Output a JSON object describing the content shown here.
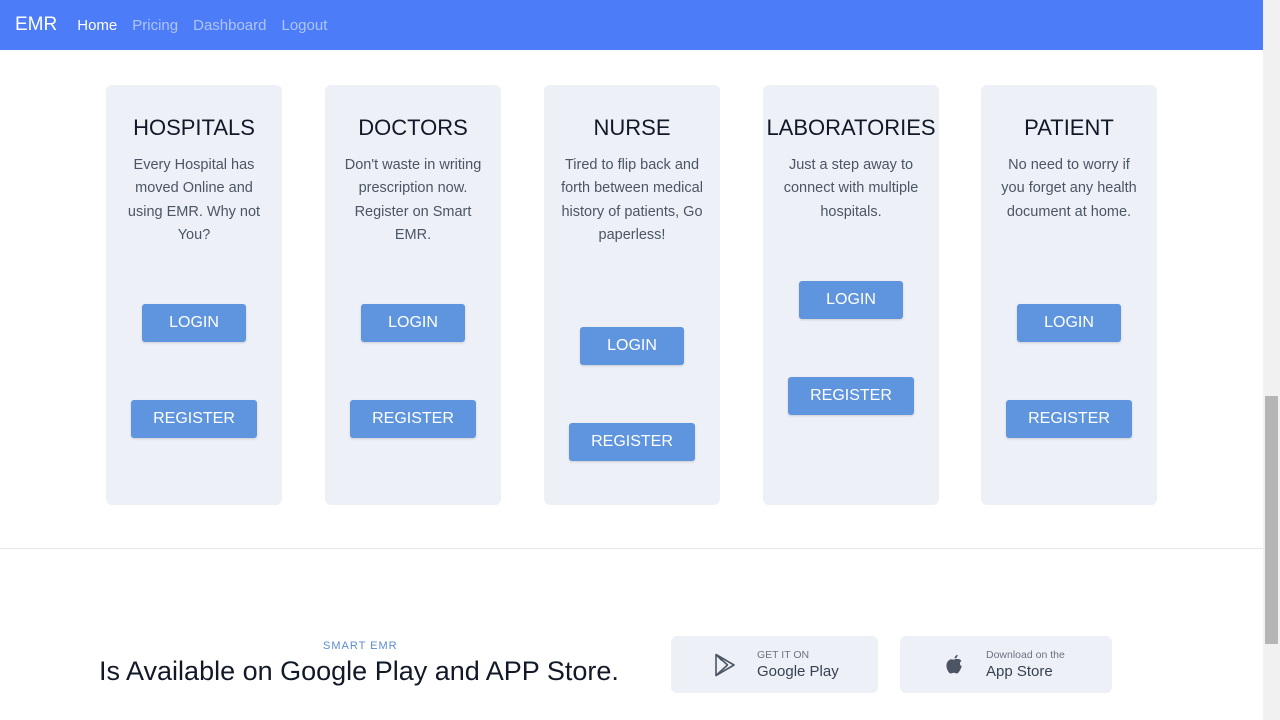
{
  "navbar": {
    "brand": "EMR",
    "links": [
      {
        "label": "Home",
        "active": true
      },
      {
        "label": "Pricing",
        "active": false
      },
      {
        "label": "Dashboard",
        "active": false
      },
      {
        "label": "Logout",
        "active": false
      }
    ]
  },
  "cards": [
    {
      "title": "HOSPITALS",
      "text": "Every Hospital has moved Online and using EMR. Why not You?",
      "login": "LOGIN",
      "register": "REGISTER"
    },
    {
      "title": "DOCTORS",
      "text": "Don't waste in writing prescription now. Register on Smart EMR.",
      "login": "LOGIN",
      "register": "REGISTER"
    },
    {
      "title": "NURSE",
      "text": "Tired to flip back and forth between medical history of patients, Go paperless!",
      "login": "LOGIN",
      "register": "REGISTER"
    },
    {
      "title": "LABORATORIES",
      "text": "Just a step away to connect with multiple hospitals.",
      "login": "LOGIN",
      "register": "REGISTER"
    },
    {
      "title": "PATIENT",
      "text": "No need to worry if you forget any health document at home.",
      "login": "LOGIN",
      "register": "REGISTER"
    }
  ],
  "availability": {
    "eyebrow": "SMART EMR",
    "headline": "Is Available on Google Play and APP Store."
  },
  "stores": {
    "google": {
      "small": "GET IT ON",
      "big": "Google Play",
      "icon": "google-play-icon"
    },
    "apple": {
      "small": "Download on the",
      "big": "App Store",
      "icon": "apple-icon"
    }
  },
  "colors": {
    "navbar": "#4c7cf8",
    "card_bg": "#edf1f7",
    "button": "#5f95df",
    "eyebrow": "#5b8bd0"
  }
}
